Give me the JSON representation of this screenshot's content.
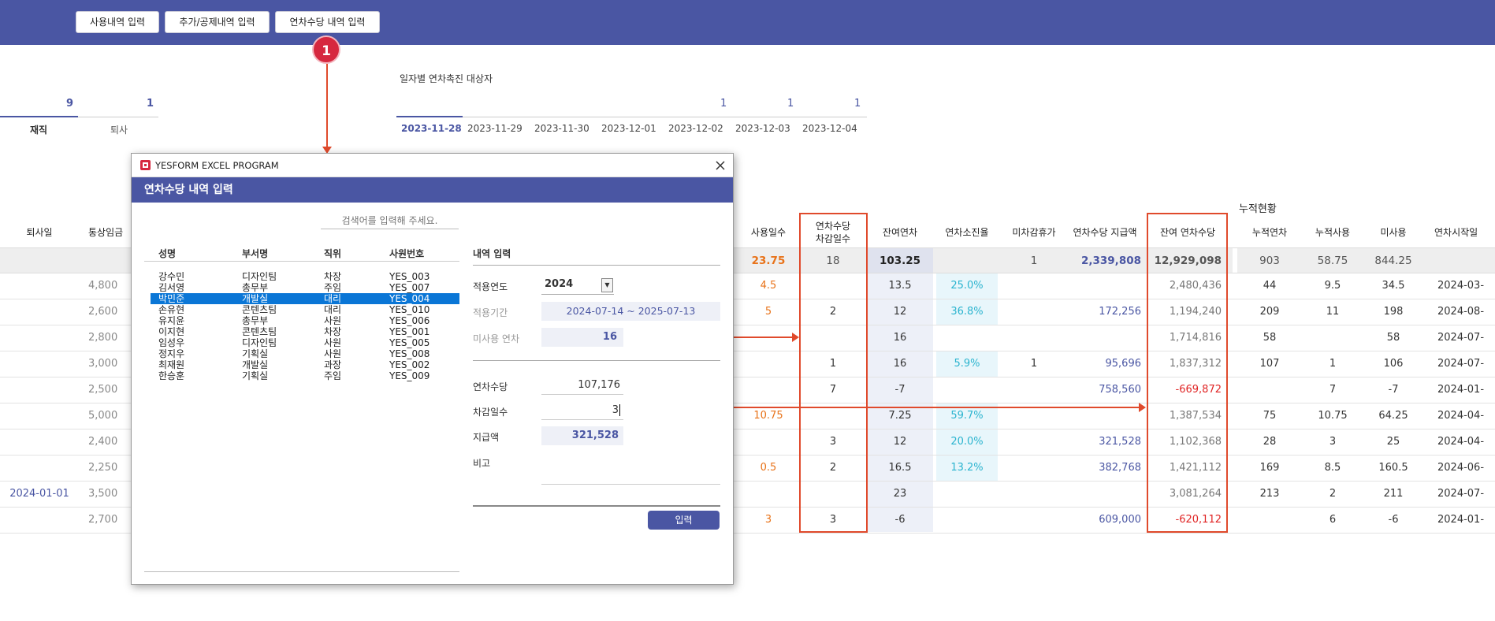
{
  "toolbar": {
    "buttons": [
      "사용내역 입력",
      "추가/공제내역 입력",
      "연차수당 내역 입력"
    ]
  },
  "marker": "1",
  "status_tabs": {
    "active_count": "9",
    "active_label": "재직",
    "retired_count": "1",
    "retired_label": "퇴사"
  },
  "promo": {
    "title": "일자별 연차촉진 대상자",
    "dates": [
      "2023-11-28",
      "2023-11-29",
      "2023-11-30",
      "2023-12-01",
      "2023-12-02",
      "2023-12-03",
      "2023-12-04"
    ],
    "counts": [
      "",
      "",
      "",
      "",
      "1",
      "1",
      "1"
    ]
  },
  "cumulative_label": "누적현황",
  "headers": {
    "retire_date": "퇴사일",
    "wage": "통상임금",
    "used_days": "사용일수",
    "deduct_days": "연차수당\n차감일수",
    "remaining_leave": "잔여연차",
    "usage_rate": "연차소진율",
    "undeducted": "미차감휴가",
    "allowance_paid": "연차수당 지급액",
    "remaining_allowance": "잔여 연차수당",
    "cum_leave": "누적연차",
    "cum_used": "누적사용",
    "cum_unused": "미사용",
    "leave_start": "연차시작일"
  },
  "summary": {
    "used_days": "23.75",
    "deduct_days": "18",
    "remaining_leave": "103.25",
    "undeducted": "1",
    "allowance_paid": "2,339,808",
    "remaining_allowance": "12,929,098",
    "cum_leave": "903",
    "cum_used": "58.75",
    "cum_unused": "844.25"
  },
  "rows": [
    {
      "retire_date": "",
      "wage": "4,800",
      "used_days": "4.5",
      "deduct_days": "",
      "remaining_leave": "13.5",
      "usage_rate": "25.0%",
      "undeducted": "",
      "allowance_paid": "",
      "remaining_allowance": "2,480,436",
      "cum_leave": "44",
      "cum_used": "9.5",
      "cum_unused": "34.5",
      "leave_start": "2024-03-"
    },
    {
      "retire_date": "",
      "wage": "2,600",
      "used_days": "5",
      "deduct_days": "2",
      "remaining_leave": "12",
      "usage_rate": "36.8%",
      "undeducted": "",
      "allowance_paid": "172,256",
      "remaining_allowance": "1,194,240",
      "cum_leave": "209",
      "cum_used": "11",
      "cum_unused": "198",
      "leave_start": "2024-08-"
    },
    {
      "retire_date": "",
      "wage": "2,800",
      "used_days": "",
      "deduct_days": "",
      "remaining_leave": "16",
      "usage_rate": "",
      "undeducted": "",
      "allowance_paid": "",
      "remaining_allowance": "1,714,816",
      "cum_leave": "58",
      "cum_used": "",
      "cum_unused": "58",
      "leave_start": "2024-07-"
    },
    {
      "retire_date": "",
      "wage": "3,000",
      "used_days": "",
      "deduct_days": "1",
      "remaining_leave": "16",
      "usage_rate": "5.9%",
      "undeducted": "1",
      "allowance_paid": "95,696",
      "remaining_allowance": "1,837,312",
      "cum_leave": "107",
      "cum_used": "1",
      "cum_unused": "106",
      "leave_start": "2024-07-"
    },
    {
      "retire_date": "",
      "wage": "2,500",
      "used_days": "",
      "deduct_days": "7",
      "remaining_leave": "-7",
      "usage_rate": "",
      "undeducted": "",
      "allowance_paid": "758,560",
      "remaining_allowance": "-669,872",
      "cum_leave": "",
      "cum_used": "7",
      "cum_unused": "-7",
      "leave_start": "2024-01-"
    },
    {
      "retire_date": "",
      "wage": "5,000",
      "used_days": "10.75",
      "deduct_days": "",
      "remaining_leave": "7.25",
      "usage_rate": "59.7%",
      "undeducted": "",
      "allowance_paid": "",
      "remaining_allowance": "1,387,534",
      "cum_leave": "75",
      "cum_used": "10.75",
      "cum_unused": "64.25",
      "leave_start": "2024-04-"
    },
    {
      "retire_date": "",
      "wage": "2,400",
      "used_days": "",
      "deduct_days": "3",
      "remaining_leave": "12",
      "usage_rate": "20.0%",
      "undeducted": "",
      "allowance_paid": "321,528",
      "remaining_allowance": "1,102,368",
      "cum_leave": "28",
      "cum_used": "3",
      "cum_unused": "25",
      "leave_start": "2024-04-"
    },
    {
      "retire_date": "",
      "wage": "2,250",
      "used_days": "0.5",
      "deduct_days": "2",
      "remaining_leave": "16.5",
      "usage_rate": "13.2%",
      "undeducted": "",
      "allowance_paid": "382,768",
      "remaining_allowance": "1,421,112",
      "cum_leave": "169",
      "cum_used": "8.5",
      "cum_unused": "160.5",
      "leave_start": "2024-06-"
    },
    {
      "retire_date": "2024-01-01",
      "wage": "3,500",
      "used_days": "",
      "deduct_days": "",
      "remaining_leave": "23",
      "usage_rate": "",
      "undeducted": "",
      "allowance_paid": "",
      "remaining_allowance": "3,081,264",
      "cum_leave": "213",
      "cum_used": "2",
      "cum_unused": "211",
      "leave_start": "2024-07-"
    },
    {
      "retire_date": "",
      "wage": "2,700",
      "used_days": "3",
      "deduct_days": "3",
      "remaining_leave": "-6",
      "usage_rate": "",
      "undeducted": "",
      "allowance_paid": "609,000",
      "remaining_allowance": "-620,112",
      "cum_leave": "",
      "cum_used": "6",
      "cum_unused": "-6",
      "leave_start": "2024-01-"
    }
  ],
  "dialog": {
    "app_title": "YESFORM EXCEL PROGRAM",
    "title": "연차수당 내역 입력",
    "search_placeholder": "검색어를 입력해 주세요.",
    "list_headers": {
      "name": "성명",
      "dept": "부서명",
      "position": "직위",
      "emp_no": "사원번호"
    },
    "employees": [
      {
        "name": "강수민",
        "dept": "디자인팀",
        "position": "차장",
        "emp_no": "YES_003"
      },
      {
        "name": "김서영",
        "dept": "총무부",
        "position": "주임",
        "emp_no": "YES_007"
      },
      {
        "name": "박민준",
        "dept": "개발실",
        "position": "대리",
        "emp_no": "YES_004"
      },
      {
        "name": "손유현",
        "dept": "콘텐츠팀",
        "position": "대리",
        "emp_no": "YES_010"
      },
      {
        "name": "유지윤",
        "dept": "총무부",
        "position": "사원",
        "emp_no": "YES_006"
      },
      {
        "name": "이지현",
        "dept": "콘텐츠팀",
        "position": "차장",
        "emp_no": "YES_001"
      },
      {
        "name": "임성우",
        "dept": "디자인팀",
        "position": "사원",
        "emp_no": "YES_005"
      },
      {
        "name": "정지우",
        "dept": "기획실",
        "position": "사원",
        "emp_no": "YES_008"
      },
      {
        "name": "최재원",
        "dept": "개발실",
        "position": "과장",
        "emp_no": "YES_002"
      },
      {
        "name": "한승훈",
        "dept": "기획실",
        "position": "주임",
        "emp_no": "YES_009"
      }
    ],
    "selected_index": 2,
    "form_title": "내역 입력",
    "year_label": "적용연도",
    "year_value": "2024",
    "period_label": "적용기간",
    "period_value": "2024-07-14 ~ 2025-07-13",
    "unused_label": "미사용 연차",
    "unused_value": "16",
    "allowance_label": "연차수당",
    "allowance_value": "107,176",
    "deduct_label": "차감일수",
    "deduct_value": "3",
    "payment_label": "지급액",
    "payment_value": "321,528",
    "note_label": "비고",
    "note_value": "",
    "submit_label": "입력"
  },
  "colors": {
    "brand": "#4a56a3",
    "highlight": "#e04a2c",
    "orange": "#e8731a",
    "teal": "#2bb4cf",
    "negative": "#e02424",
    "selection": "#0a76d6"
  }
}
